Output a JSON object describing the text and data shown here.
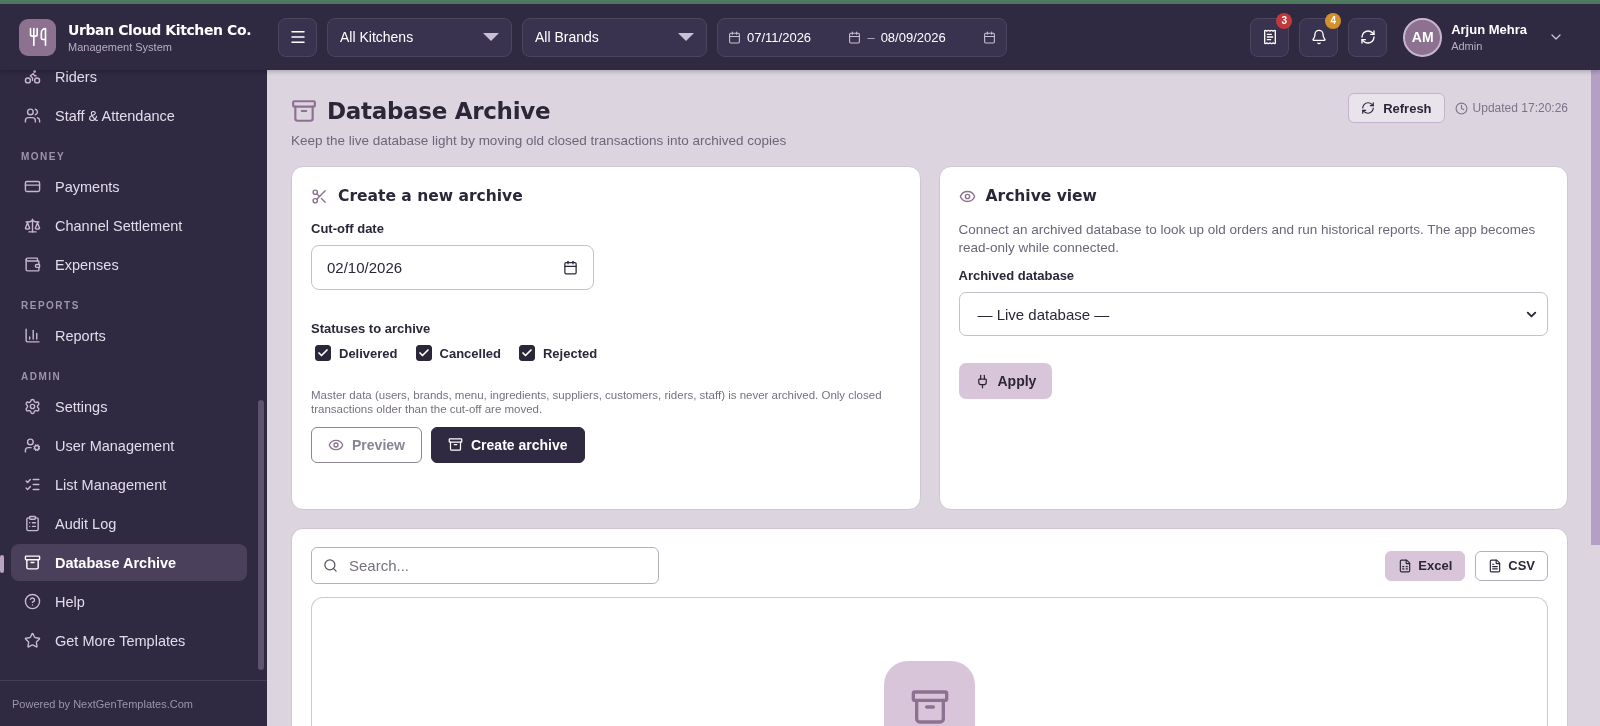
{
  "brand": {
    "title": "Urban Cloud Kitchen Co.",
    "subtitle": "Management System"
  },
  "topbar": {
    "filters": [
      {
        "label": "All Kitchens"
      },
      {
        "label": "All Brands"
      }
    ],
    "date_from": "07/11/2026",
    "date_separator": "–",
    "date_to": "08/09/2026",
    "icon_buttons": [
      {
        "kind": "receipt",
        "badge": "3",
        "color": "#c0393b"
      },
      {
        "kind": "bell",
        "badge": "4",
        "color": "#d4902a"
      },
      {
        "kind": "sync"
      }
    ],
    "user": {
      "initials": "AM",
      "name": "Arjun Mehra",
      "role": "Admin"
    }
  },
  "sidebar": {
    "groups": [
      {
        "items": [
          {
            "label": "Riders",
            "selected": false
          },
          {
            "label": "Staff & Attendance",
            "selected": false
          }
        ]
      },
      {
        "heading": "MONEY",
        "items": [
          {
            "label": "Payments",
            "selected": false
          },
          {
            "label": "Channel Settlement",
            "selected": false
          },
          {
            "label": "Expenses",
            "selected": false
          }
        ]
      },
      {
        "heading": "REPORTS",
        "items": [
          {
            "label": "Reports",
            "selected": false
          }
        ]
      },
      {
        "heading": "ADMIN",
        "items": [
          {
            "label": "Settings",
            "selected": false
          },
          {
            "label": "User Management",
            "selected": false
          },
          {
            "label": "List Management",
            "selected": false
          },
          {
            "label": "Audit Log",
            "selected": false
          },
          {
            "label": "Database Archive",
            "selected": true
          },
          {
            "label": "Help",
            "selected": false
          },
          {
            "label": "Get More Templates",
            "selected": false
          }
        ]
      }
    ],
    "footer": "Powered by NextGenTemplates.Com"
  },
  "page": {
    "title": "Database Archive",
    "subtitle": "Keep the live database light by moving old closed transactions into archived copies",
    "refresh": "Refresh",
    "updated": "Updated 17:20:26"
  },
  "create_card": {
    "title": "Create a new archive",
    "cutoff_label": "Cut-off date",
    "cutoff_value": "02/10/2026",
    "statuses_label": "Statuses to archive",
    "statuses": [
      {
        "label": "Delivered",
        "checked": true
      },
      {
        "label": "Cancelled",
        "checked": true
      },
      {
        "label": "Rejected",
        "checked": true
      }
    ],
    "note": "Master data (users, brands, menu, ingredients, suppliers, customers, riders, staff) is never archived. Only closed transactions older than the cut-off are moved.",
    "buttons": [
      {
        "label": "Preview",
        "kind": "outline"
      },
      {
        "label": "Create archive",
        "kind": "primary"
      }
    ]
  },
  "view_card": {
    "title": "Archive view",
    "description": "Connect an archived database to look up old orders and run historical reports. The app becomes read-only while connected.",
    "select_label": "Archived database",
    "select_value": "— Live database —",
    "apply": "Apply"
  },
  "results": {
    "search": {
      "placeholder": "Search..."
    },
    "exports": [
      {
        "label": "Excel",
        "kind": "filled"
      },
      {
        "label": "CSV",
        "kind": "outline"
      }
    ]
  }
}
